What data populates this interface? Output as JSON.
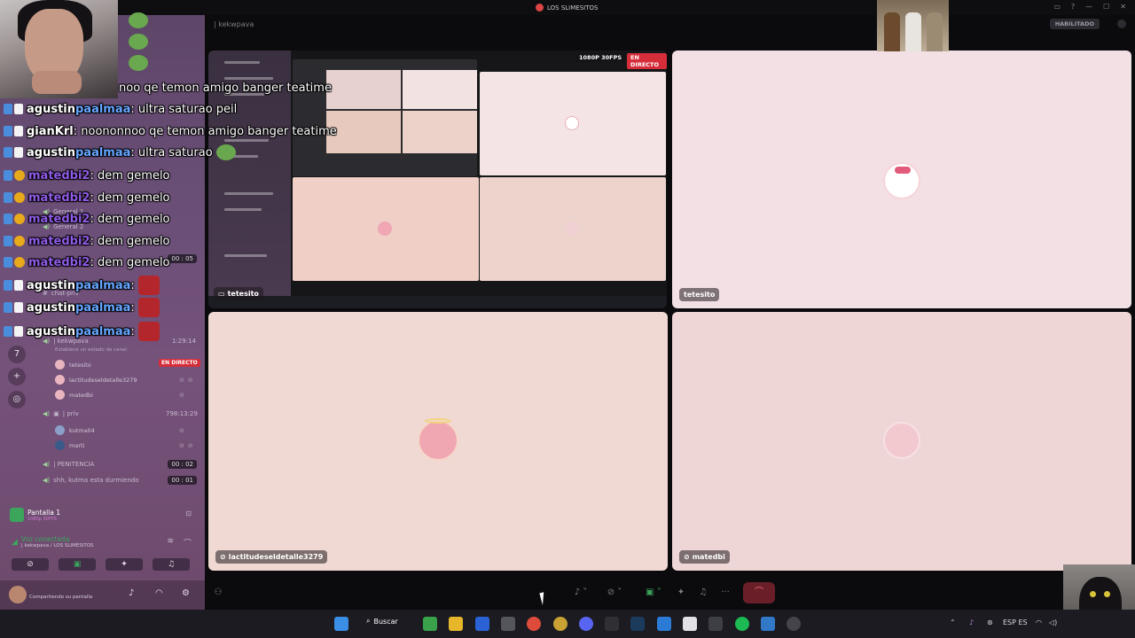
{
  "window": {
    "title": "LOS SLIMESITOS"
  },
  "topbar": {
    "channel": "| kekwpava",
    "estado_button": "HABILITADO"
  },
  "stream_overlay": {
    "quality": "1080P 30FPS",
    "live": "EN DIRECTO"
  },
  "chat": [
    {
      "name_pre": "",
      "name_hl": "",
      "name": "",
      "text": "noo qe temon amigo banger teatime",
      "emote": ""
    },
    {
      "name_pre": "agustin",
      "name_hl": "paalmaa",
      "text": ": ultra saturao peil",
      "emote": ""
    },
    {
      "name": "gianKrl",
      "text": ": noononnoo qe temon amigo banger teatime",
      "emote": ""
    },
    {
      "name_pre": "agustin",
      "name_hl": "paalmaa",
      "text": ": ultra saturao",
      "emote": "frog"
    },
    {
      "name": "matedbi2",
      "text": ": dem gemelo",
      "emote": ""
    },
    {
      "name": "matedbi2",
      "text": ": dem gemelo",
      "emote": ""
    },
    {
      "name": "matedbi2",
      "text": ": dem gemelo",
      "emote": ""
    },
    {
      "name": "matedbi2",
      "text": ": dem gemelo",
      "emote": ""
    },
    {
      "name": "matedbi2",
      "text": ": dem gemelo",
      "emote": ""
    },
    {
      "name_pre": "agustin",
      "name_hl": "paalmaa",
      "text": ":",
      "emote": "red"
    },
    {
      "name_pre": "agustin",
      "name_hl": "paalmaa",
      "text": ":",
      "emote": "red"
    },
    {
      "name_pre": "agustin",
      "name_hl": "paalmaa",
      "text": ":",
      "emote": "red"
    }
  ],
  "sidebar": {
    "channels": {
      "general1": "General 1",
      "general2": "General 2",
      "chat_priv": "chat-priv",
      "kekwpava": "| kekwpava",
      "kekwpava_time": "1:29:14",
      "estado": "Establece un estado de canal",
      "priv": "| priv",
      "priv_time": "798:13:29",
      "penitencia": "| PENITENCIA",
      "penitencia_time": "00 : 02",
      "shh": "shh, kutma esta durmiendo",
      "shh_time": "00 : 01",
      "top_time": "00 : 05"
    },
    "members": {
      "tetesito": "tetesito",
      "live_badge": "EN DIRECTO",
      "lactitude": "lactitudeseldetalle3279",
      "matedbi": "matedbi",
      "kutma": "kutma04",
      "marti": "marti"
    },
    "screen_panel": {
      "title": "Pantalla 1",
      "sub": "1080p 30FPS"
    },
    "voice_panel": {
      "title": "Voz conectada",
      "sub": "| kekwpava / LOS SLIMESITOS"
    },
    "user_panel": {
      "name": "",
      "status": "Compartiendo su pantalla"
    }
  },
  "tiles": {
    "stream_label": "tetesito",
    "top_right_label": "tetesito",
    "bottom_left_label": "lactitudeseldetalle3279",
    "bottom_right_label": "matedbi"
  },
  "taskbar": {
    "search": "Buscar",
    "lang": "ESP ES"
  },
  "colors": {
    "live": "#d62d3a",
    "hangup": "#6a1f28",
    "sidebar": "#6b4f78",
    "tile_pink": "#f2dde0"
  }
}
